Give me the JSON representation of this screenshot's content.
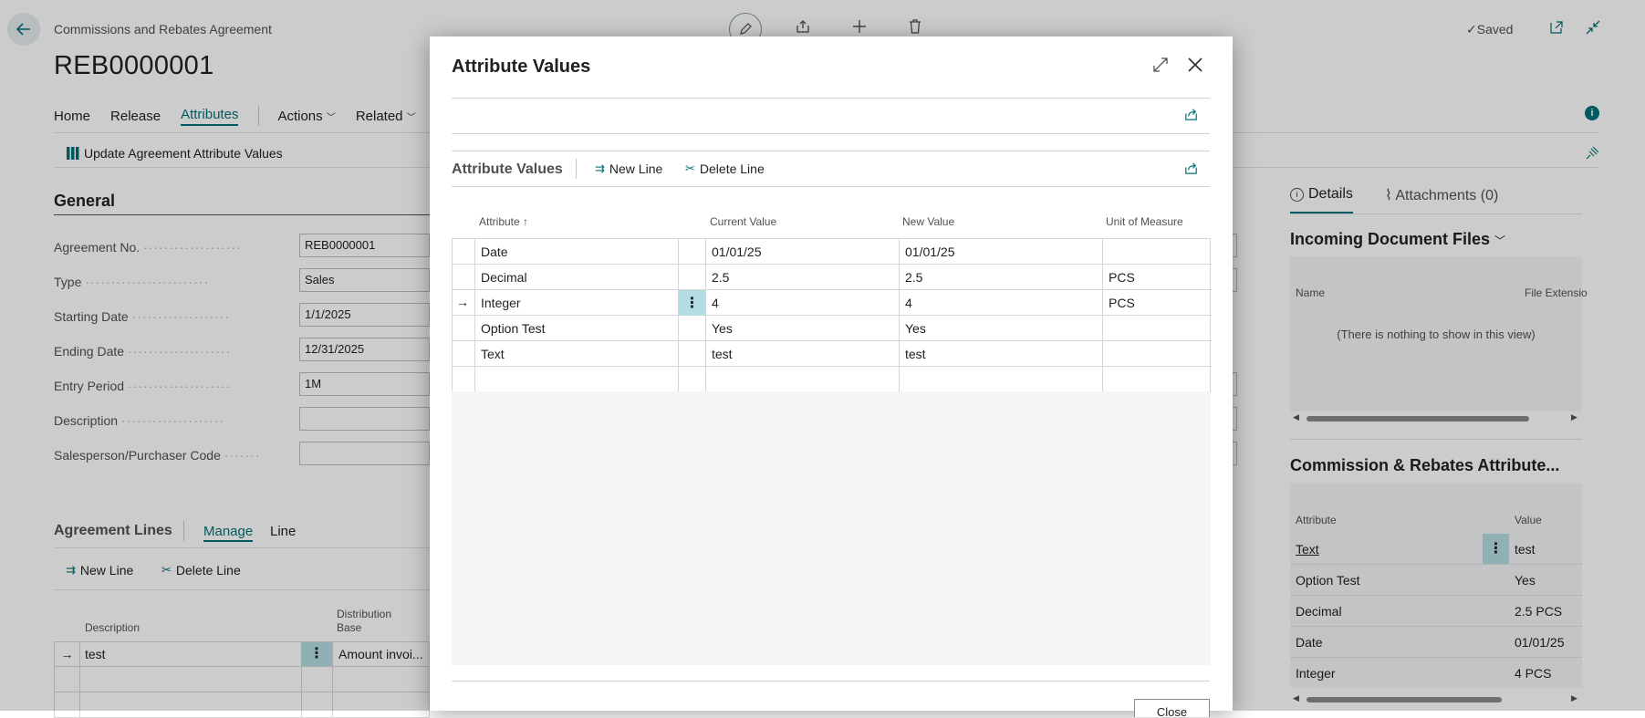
{
  "page": {
    "breadcrumb": "Commissions and Rebates Agreement",
    "title": "REB0000001",
    "saved_label": "Saved",
    "nav": {
      "home": "Home",
      "release": "Release",
      "attributes": "Attributes",
      "actions": "Actions",
      "related": "Related"
    },
    "update_action": "Update Agreement Attribute Values",
    "general": {
      "title": "General",
      "fields": [
        {
          "label": "Agreement No.",
          "value": "REB0000001"
        },
        {
          "label": "Type",
          "value": "Sales"
        },
        {
          "label": "Starting Date",
          "value": "1/1/2025"
        },
        {
          "label": "Ending Date",
          "value": "12/31/2025"
        },
        {
          "label": "Entry Period",
          "value": "1M"
        },
        {
          "label": "Description",
          "value": ""
        },
        {
          "label": "Salesperson/Purchaser Code",
          "value": ""
        }
      ]
    },
    "lines": {
      "title": "Agreement Lines",
      "tab_manage": "Manage",
      "tab_line": "Line",
      "new_line": "New Line",
      "delete_line": "Delete Line",
      "col_description": "Description",
      "col_distribution_line1": "Distribution",
      "col_distribution_line2": "Base",
      "row_description": "test",
      "row_distribution": "Amount invoi..."
    },
    "factbox": {
      "tab_details": "Details",
      "tab_attachments": "Attachments (0)",
      "incoming_title": "Incoming Document Files",
      "col_name": "Name",
      "col_file_ext": "File Extensio",
      "empty_text": "(There is nothing to show in this view)",
      "attr_title": "Commission & Rebates Attribute...",
      "col_attribute": "Attribute",
      "col_value": "Value",
      "rows": [
        {
          "attribute": "Text",
          "value": "test"
        },
        {
          "attribute": "Option Test",
          "value": "Yes"
        },
        {
          "attribute": "Decimal",
          "value": "2.5 PCS"
        },
        {
          "attribute": "Date",
          "value": "01/01/25"
        },
        {
          "attribute": "Integer",
          "value": "4 PCS"
        }
      ]
    }
  },
  "dialog": {
    "title": "Attribute Values",
    "subpage_title": "Attribute Values",
    "new_line": "New Line",
    "delete_line": "Delete Line",
    "columns": {
      "attribute": "Attribute",
      "current_value": "Current Value",
      "new_value": "New Value",
      "unit": "Unit of Measure"
    },
    "rows": [
      {
        "attribute": "Date",
        "current": "01/01/25",
        "new": "01/01/25",
        "unit": ""
      },
      {
        "attribute": "Decimal",
        "current": "2.5",
        "new": "2.5",
        "unit": "PCS"
      },
      {
        "attribute": "Integer",
        "current": "4",
        "new": "4",
        "unit": "PCS"
      },
      {
        "attribute": "Option Test",
        "current": "Yes",
        "new": "Yes",
        "unit": ""
      },
      {
        "attribute": "Text",
        "current": "test",
        "new": "test",
        "unit": ""
      }
    ],
    "close_label": "Close"
  },
  "colors": {
    "accent": "#00707a",
    "selected_cell": "#b3dde2"
  }
}
